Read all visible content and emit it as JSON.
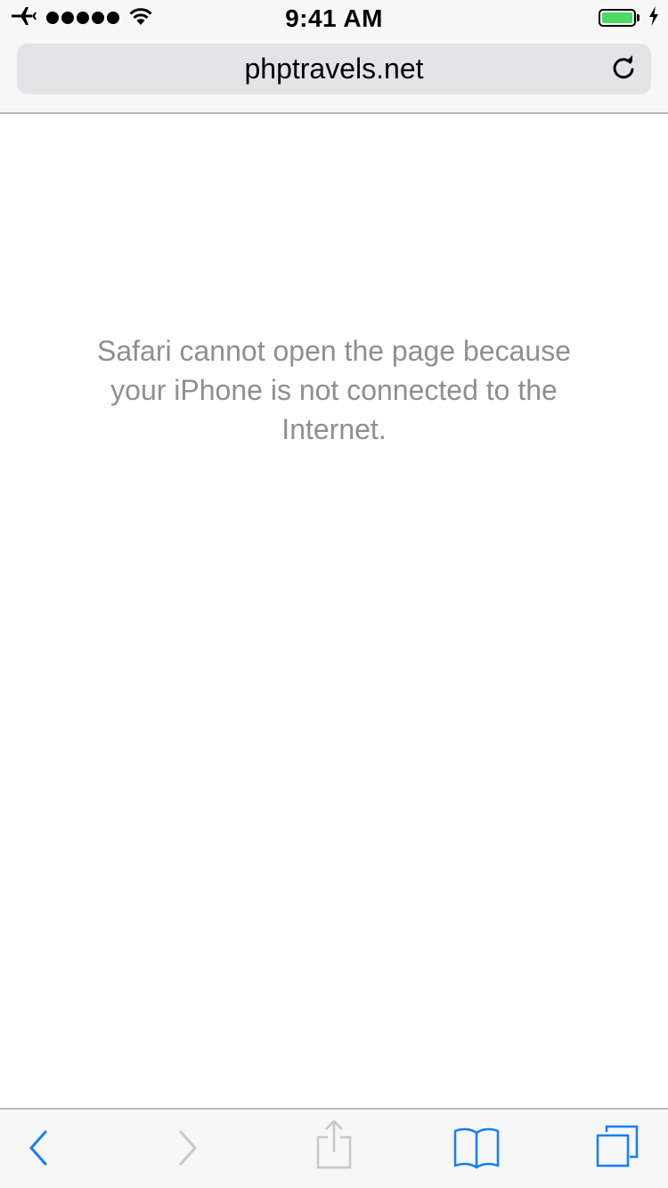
{
  "status_bar": {
    "time": "9:41 AM",
    "airplane_mode": true,
    "signal_dots": 5,
    "wifi": true,
    "battery_level": 1.0,
    "charging": true,
    "battery_color": "#4cd964"
  },
  "address_bar": {
    "url": "phptravels.net",
    "reload_icon": "reload-icon"
  },
  "error": {
    "message": "Safari cannot open the page because your iPhone is not connected to the Internet."
  },
  "toolbar": {
    "back_icon": "chevron-left-icon",
    "forward_icon": "chevron-right-icon",
    "share_icon": "share-icon",
    "bookmarks_icon": "book-icon",
    "tabs_icon": "tabs-icon",
    "active_color": "#157efb",
    "disabled_color": "#c7c7cc"
  }
}
